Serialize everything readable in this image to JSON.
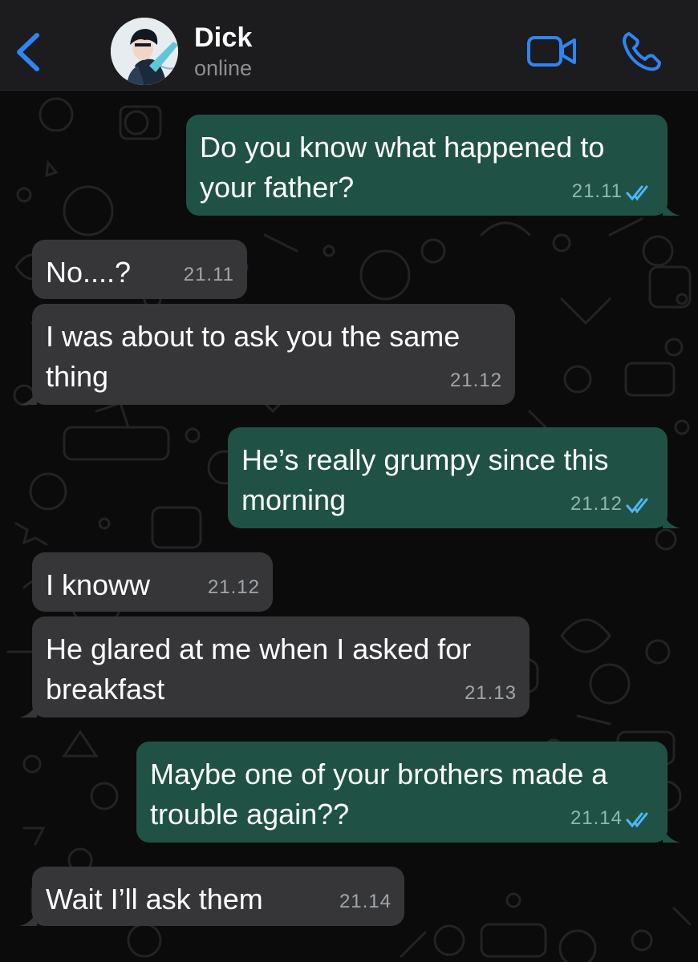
{
  "header": {
    "contact_name": "Dick",
    "status": "online"
  },
  "colors": {
    "accent": "#2f85f5",
    "incoming_bubble": "#363638",
    "outgoing_bubble": "#1f5245",
    "read_ticks": "#4fb6f6"
  },
  "messages": [
    {
      "direction": "out",
      "lines": [
        "Do you know what happened to",
        "your father?"
      ],
      "time": "21.11",
      "status": "read"
    },
    {
      "direction": "in",
      "lines": [
        "No....?"
      ],
      "time": "21.11"
    },
    {
      "direction": "in",
      "lines": [
        "I was about to ask you the same",
        "thing"
      ],
      "time": "21.12"
    },
    {
      "direction": "out",
      "lines": [
        "He’s really grumpy since this",
        "morning"
      ],
      "time": "21.12",
      "status": "read"
    },
    {
      "direction": "in",
      "lines": [
        "I knoww"
      ],
      "time": "21.12"
    },
    {
      "direction": "in",
      "lines": [
        "He glared at me when I asked for",
        "breakfast"
      ],
      "time": "21.13"
    },
    {
      "direction": "out",
      "lines": [
        "Maybe one of your brothers made a",
        "trouble again??"
      ],
      "time": "21.14",
      "status": "read"
    },
    {
      "direction": "in",
      "lines": [
        "Wait I’ll ask them"
      ],
      "time": "21.14"
    }
  ]
}
